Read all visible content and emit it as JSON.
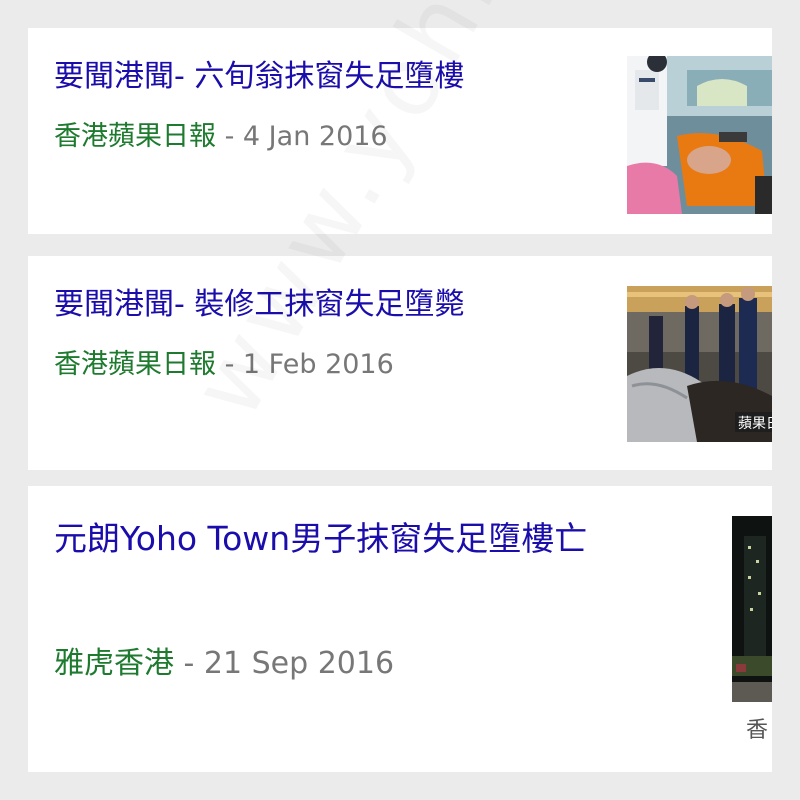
{
  "results": [
    {
      "title": "要聞港聞- 六旬翁抹窗失足墮樓",
      "source": "香港蘋果日報",
      "separator": " - ",
      "date": "4 Jan 2016"
    },
    {
      "title": "要聞港聞- 裝修工抹窗失足墮斃",
      "source": "香港蘋果日報",
      "separator": " - ",
      "date": "1 Feb 2016",
      "thumbnail_caption": "蘋果日"
    },
    {
      "title": "元朗Yoho Town男子抹窗失足墮樓亡",
      "source": "雅虎香港",
      "separator": " - ",
      "date": "21 Sep 2016",
      "thumbnail_caption": "香"
    }
  ],
  "watermark": "www.yohk",
  "colors": {
    "title": "#1a0dab",
    "source": "#1e7a2e",
    "meta": "#777777",
    "background": "#ebebeb",
    "card": "#ffffff"
  }
}
